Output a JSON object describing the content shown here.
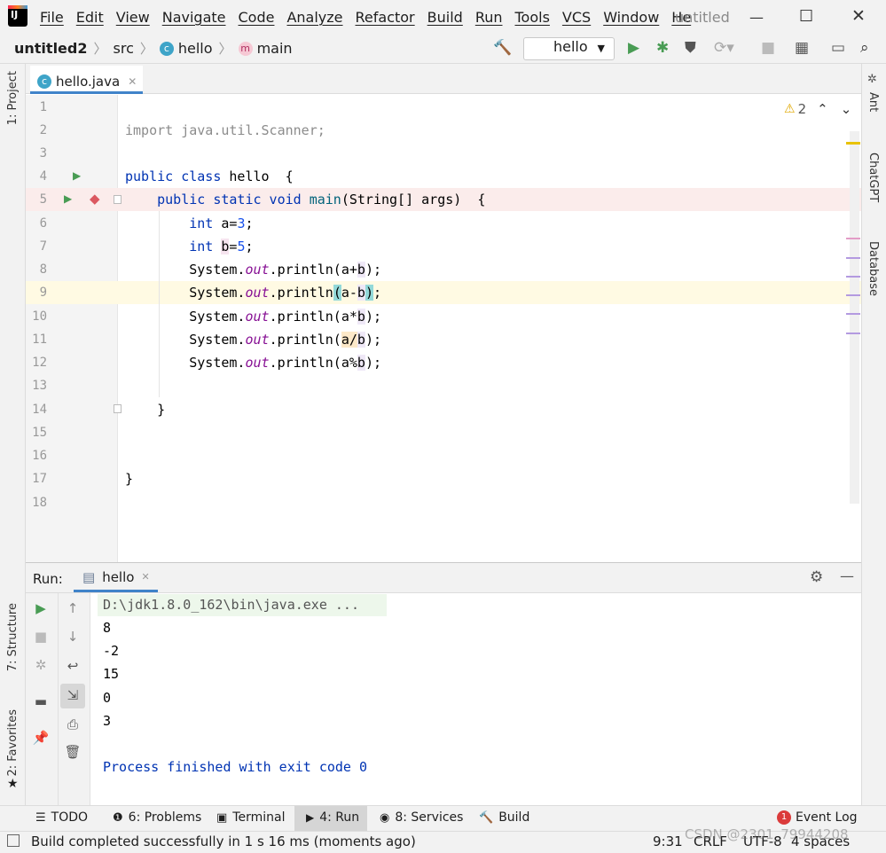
{
  "menu": {
    "items": [
      "File",
      "Edit",
      "View",
      "Navigate",
      "Code",
      "Analyze",
      "Refactor",
      "Build",
      "Run",
      "Tools",
      "VCS",
      "Window",
      "Hе"
    ],
    "window_title": "untitled"
  },
  "breadcrumb": {
    "project": "untitled2",
    "folder": "src",
    "class": "hello",
    "method": "main"
  },
  "run_config": "hello",
  "left_strip": {
    "project": "1: Project",
    "structure": "7: Structure",
    "favorites": "2: Favorites"
  },
  "right_strip": {
    "ant": "Ant",
    "chatgpt": "ChatGPT",
    "database": "Database"
  },
  "editor": {
    "tab": "hello.java",
    "warnings": "2",
    "line_numbers": [
      "1",
      "2",
      "3",
      "4",
      "5",
      "6",
      "7",
      "8",
      "9",
      "10",
      "11",
      "12",
      "13",
      "14",
      "15",
      "16",
      "17",
      "18"
    ]
  },
  "run_panel": {
    "label": "Run:",
    "tab": "hello"
  },
  "console": {
    "cmd": "D:\\jdk1.8.0_162\\bin\\java.exe ...",
    "lines": [
      "8",
      "-2",
      "15",
      "0",
      "3"
    ],
    "finished": "Process finished with exit code 0"
  },
  "bottom_tabs": {
    "todo": "TODO",
    "problems": "6: Problems",
    "terminal": "Terminal",
    "run": "4: Run",
    "services": "8: Services",
    "build": "Build",
    "event_log": "Event Log",
    "event_count": "1"
  },
  "status": {
    "message": "Build completed successfully in 1 s 16 ms (moments ago)",
    "position": "9:31",
    "line_sep": "CRLF",
    "encoding": "UTF-8",
    "indent": "4 spaces",
    "watermark": "CSDN @2301_79944208"
  },
  "colors": {
    "accent": "#4083c9",
    "run_green": "#499c54",
    "breakpoint": "#db5860",
    "highlight_line": "#fdf5f3",
    "caret_line": "#fffae3"
  }
}
